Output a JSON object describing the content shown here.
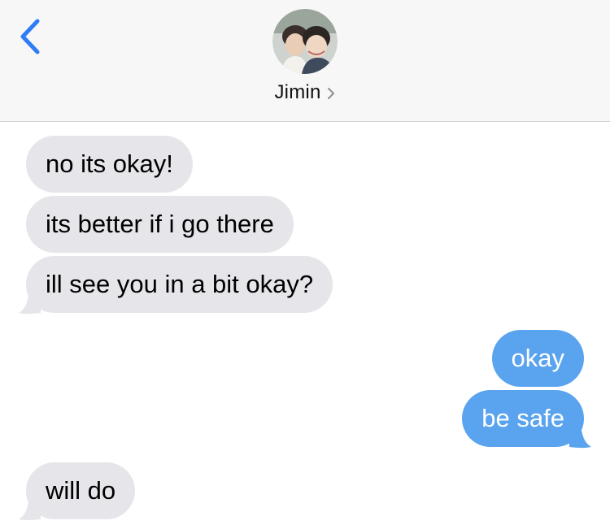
{
  "header": {
    "contact_name": "Jimin"
  },
  "messages": [
    {
      "direction": "received",
      "text": "no its okay!"
    },
    {
      "direction": "received",
      "text": "its better if i go there"
    },
    {
      "direction": "received",
      "text": "ill see you in a bit okay?"
    },
    {
      "direction": "sent",
      "text": "okay"
    },
    {
      "direction": "sent",
      "text": "be safe"
    },
    {
      "direction": "received",
      "text": "will do"
    }
  ],
  "colors": {
    "sent_bubble": "#5aa3ef",
    "received_bubble": "#e5e5ea",
    "accent": "#2f7cf6"
  },
  "icons": {
    "back": "chevron-left-icon",
    "contact_detail": "chevron-right-icon"
  }
}
